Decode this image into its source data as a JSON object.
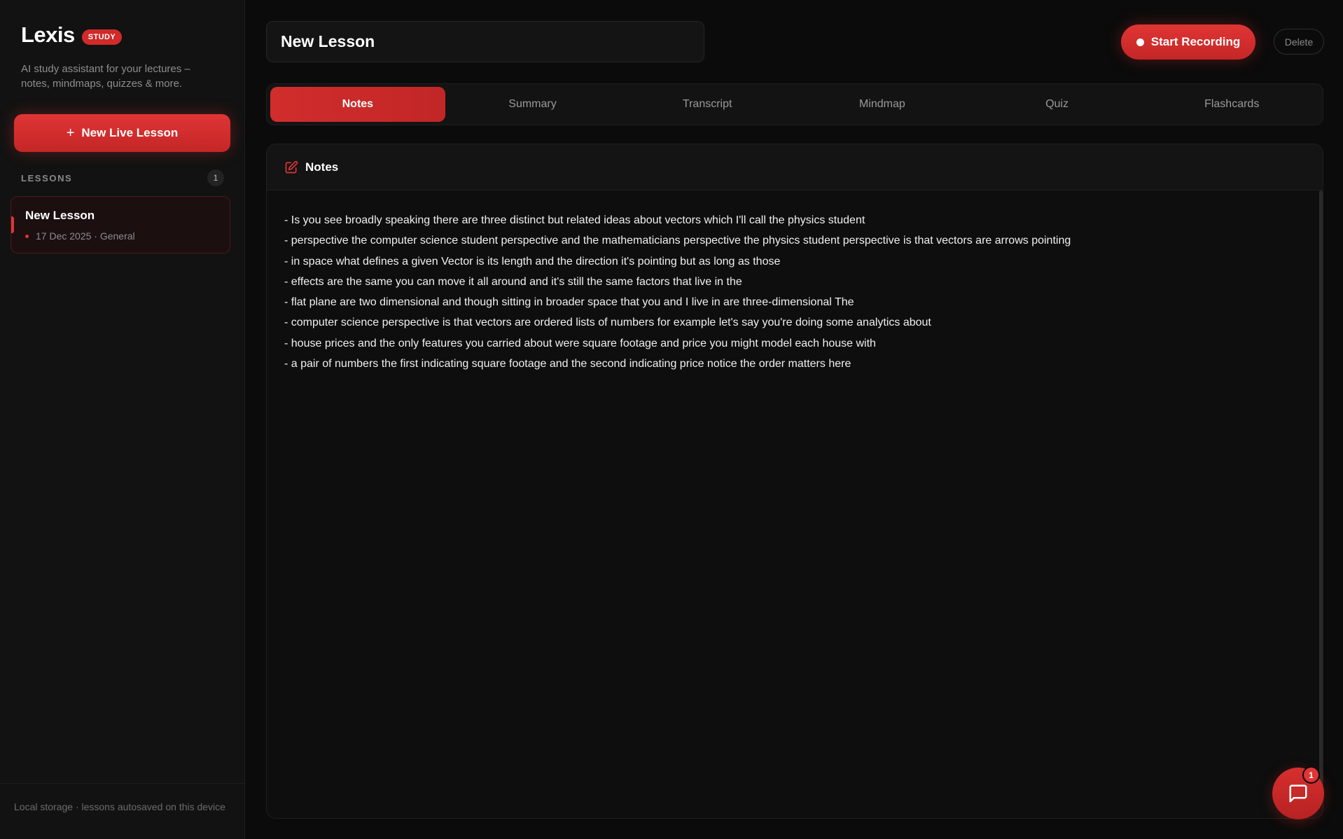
{
  "sidebar": {
    "brand_name": "Lexis",
    "brand_badge": "STUDY",
    "tagline": "AI study assistant for your lectures – notes, mindmaps, quizzes & more.",
    "new_lesson_label": "New Live Lesson",
    "lessons_label": "LESSONS",
    "lessons_count": "1",
    "lessons": [
      {
        "title": "New Lesson",
        "meta": "17 Dec 2025 · General"
      }
    ],
    "footer": "Local storage · lessons autosaved on this device"
  },
  "header": {
    "lesson_title_value": "New Lesson",
    "record_label": "Start Recording",
    "delete_label": "Delete"
  },
  "tabs": [
    {
      "label": "Notes",
      "active": true
    },
    {
      "label": "Summary",
      "active": false
    },
    {
      "label": "Transcript",
      "active": false
    },
    {
      "label": "Mindmap",
      "active": false
    },
    {
      "label": "Quiz",
      "active": false
    },
    {
      "label": "Flashcards",
      "active": false
    }
  ],
  "notes": {
    "title": "Notes",
    "lines": [
      "- Is you see broadly speaking there are three distinct but related ideas about vectors which I'll call the physics student",
      "- perspective the computer science student perspective and the mathematicians perspective the physics student perspective is that vectors are arrows pointing",
      "- in space what defines a given Vector is its length and the direction it's pointing but as long as those",
      "- effects are the same you can move it all around and it's still the same factors that live in the",
      "- flat plane are two dimensional and though sitting in broader space that you and I live in are three-dimensional The",
      "- computer science perspective is that vectors are ordered lists of numbers for example let's say you're doing some analytics about",
      "- house prices and the only features you carried about were square footage and price you might model each house with",
      "- a pair of numbers the first indicating square footage and the second indicating price notice the order matters here"
    ]
  },
  "chat": {
    "badge_count": "1"
  },
  "colors": {
    "accent": "#e03535",
    "background": "#0b0b0b",
    "sidebar": "#121212"
  },
  "icons": {
    "notes": "edit-icon",
    "chat": "chat-icon",
    "new_lesson": "plus-icon",
    "record": "record-dot-icon"
  }
}
